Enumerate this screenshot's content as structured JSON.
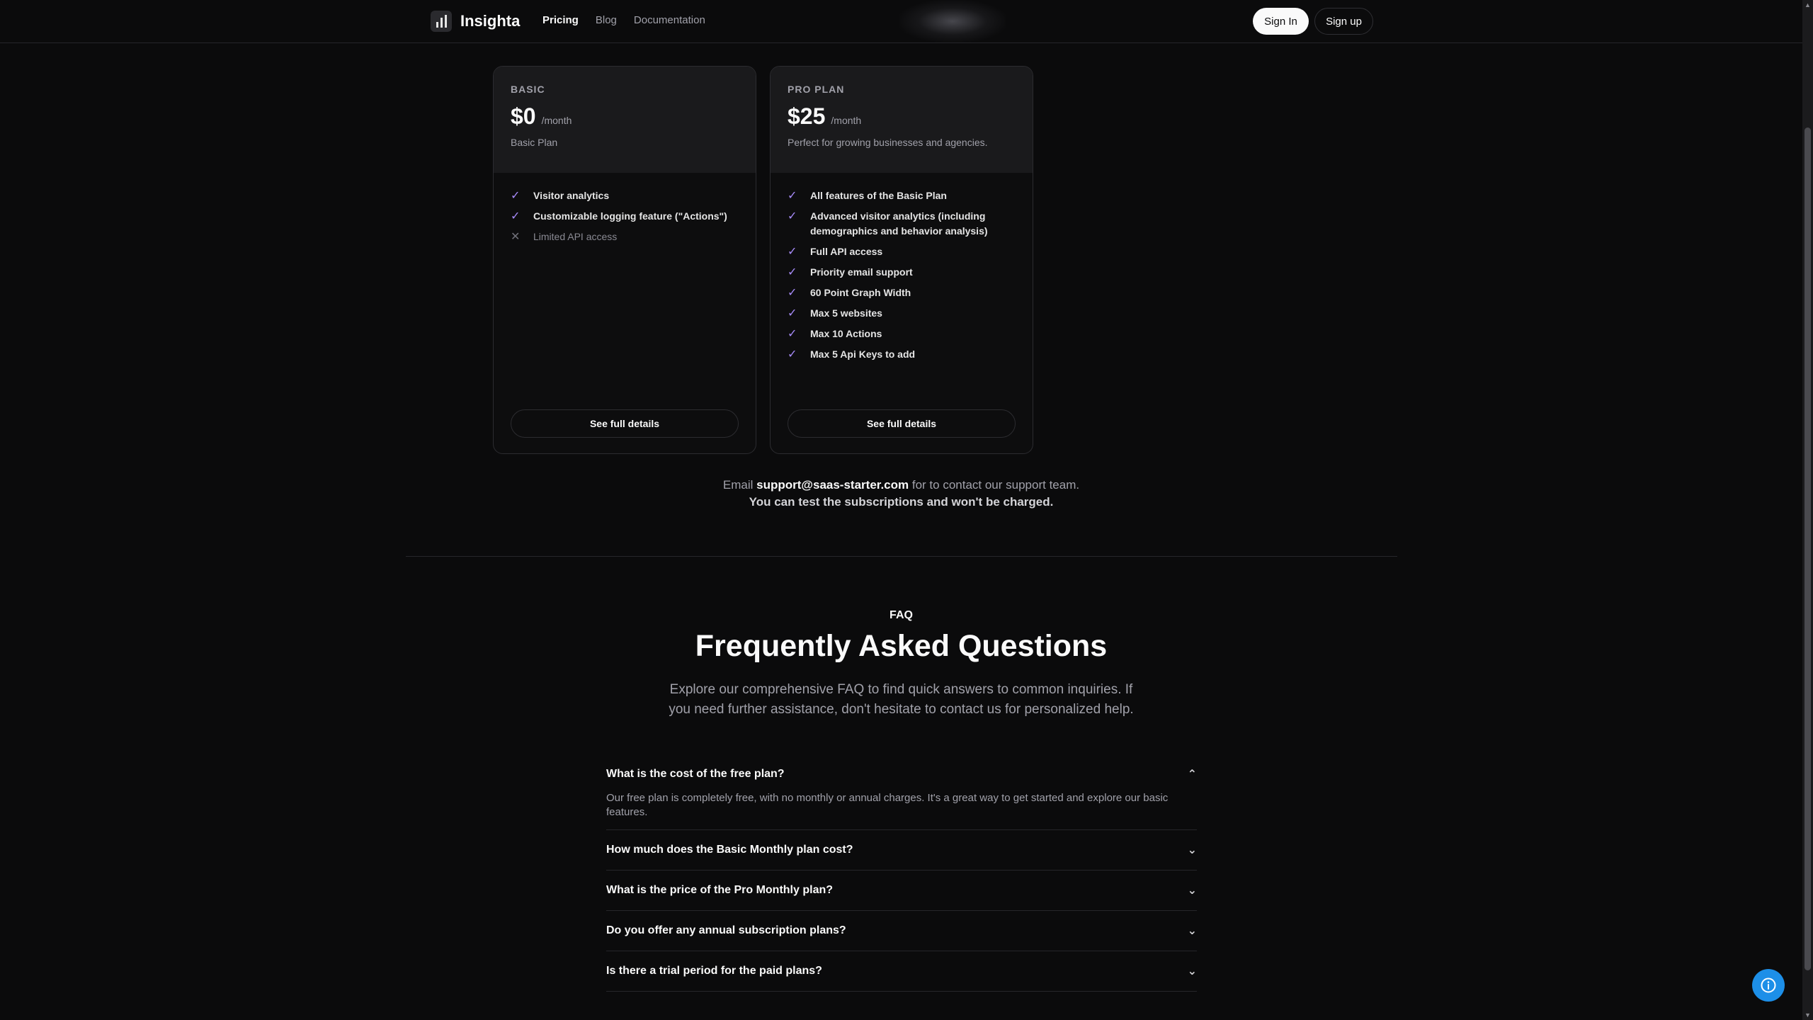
{
  "nav": {
    "brand": "Insighta",
    "links": [
      "Pricing",
      "Blog",
      "Documentation"
    ],
    "sign_in": "Sign In",
    "sign_up": "Sign up"
  },
  "plans": [
    {
      "label": "BASIC",
      "price": "$0",
      "period": "/month",
      "description": "Basic Plan",
      "features": [
        {
          "text": "Visitor analytics",
          "included": true
        },
        {
          "text": "Customizable logging feature (\"Actions\")",
          "included": true
        },
        {
          "text": "Limited API access",
          "included": false
        }
      ],
      "cta": "See full details"
    },
    {
      "label": "PRO PLAN",
      "price": "$25",
      "period": "/month",
      "description": "Perfect for growing businesses and agencies.",
      "features": [
        {
          "text": "All features of the Basic Plan",
          "included": true
        },
        {
          "text": "Advanced visitor analytics (including demographics and behavior analysis)",
          "included": true
        },
        {
          "text": "Full API access",
          "included": true
        },
        {
          "text": "Priority email support",
          "included": true
        },
        {
          "text": "60 Point Graph Width",
          "included": true
        },
        {
          "text": "Max 5 websites",
          "included": true
        },
        {
          "text": "Max 10 Actions",
          "included": true
        },
        {
          "text": "Max 5 Api Keys to add",
          "included": true
        }
      ],
      "cta": "See full details"
    }
  ],
  "support": {
    "prefix": "Email",
    "email": "support@saas-starter.com",
    "suffix": "for to contact our support team.",
    "note": "You can test the subscriptions and won't be charged."
  },
  "faq": {
    "tag": "FAQ",
    "title": "Frequently Asked Questions",
    "subtitle_line1": "Explore our comprehensive FAQ to find quick answers to common inquiries. If",
    "subtitle_line2": "you need further assistance, don't hesitate to contact us for personalized help.",
    "items": [
      {
        "question": "What is the cost of the free plan?",
        "answer": "Our free plan is completely free, with no monthly or annual charges. It's a great way to get started and explore our basic features.",
        "expanded": true
      },
      {
        "question": "How much does the Basic Monthly plan cost?",
        "expanded": false
      },
      {
        "question": "What is the price of the Pro Monthly plan?",
        "expanded": false
      },
      {
        "question": "Do you offer any annual subscription plans?",
        "expanded": false
      },
      {
        "question": "Is there a trial period for the paid plans?",
        "expanded": false
      }
    ]
  },
  "colors": {
    "background": "#0b0b0c",
    "card_header": "#1a1a1c",
    "check": "#a78bfa",
    "info_button": "#1d8fe8"
  },
  "icons": {
    "check": "check-icon",
    "cross": "x-icon",
    "chevron_up": "chevron-up-icon",
    "chevron_down": "chevron-down-icon",
    "info": "info-icon"
  }
}
